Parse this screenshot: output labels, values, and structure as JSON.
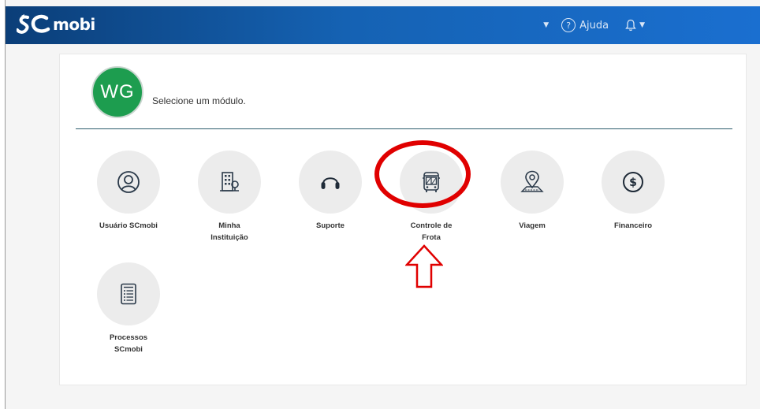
{
  "header": {
    "brand": "mobi",
    "brand_prefix": "SC",
    "help_label": "Ajuda",
    "help_icon": "question-circle-icon",
    "notifications_icon": "bell-icon",
    "dropdown_icon": "caret-down-icon",
    "colors": {
      "bar_start": "#0b3e78",
      "bar_end": "#1a6fd0"
    }
  },
  "user": {
    "initials": "WG",
    "avatar_color": "#1d9d4f",
    "prompt": "Selecione um módulo."
  },
  "modules": [
    {
      "line1": "Usuário SCmobi",
      "line2": "",
      "icon": "user-circle-icon"
    },
    {
      "line1": "Minha",
      "line2": "Instituição",
      "icon": "building-icon"
    },
    {
      "line1": "Suporte",
      "line2": "",
      "icon": "headset-icon"
    },
    {
      "line1": "Controle de",
      "line2": "Frota",
      "icon": "bus-icon"
    },
    {
      "line1": "Viagem",
      "line2": "",
      "icon": "map-pin-icon"
    },
    {
      "line1": "Financeiro",
      "line2": "",
      "icon": "dollar-circle-icon"
    },
    {
      "line1": "Processos",
      "line2": "SCmobi",
      "icon": "checklist-icon"
    }
  ],
  "annotation": {
    "highlight_color": "#e00000",
    "highlighted_module": "Controle de Frota",
    "marks": [
      "red-circle",
      "up-arrow"
    ]
  }
}
